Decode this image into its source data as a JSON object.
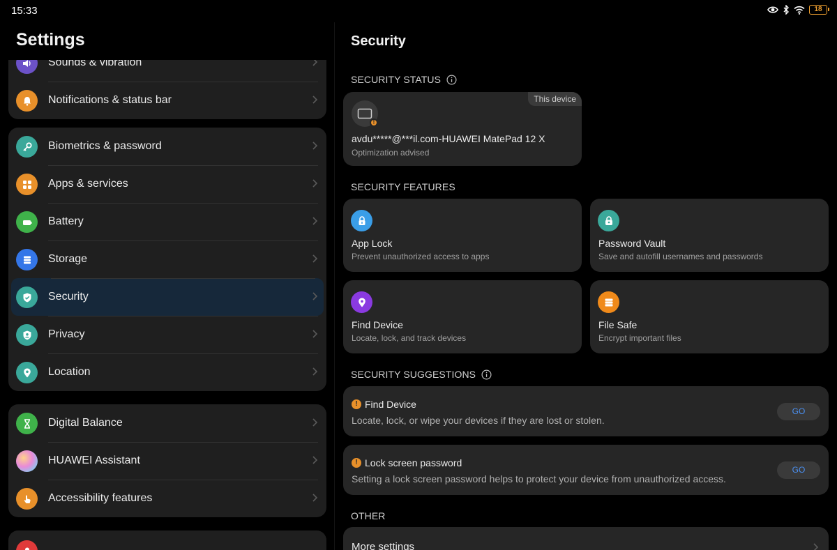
{
  "status_bar": {
    "time": "15:33",
    "battery": "18"
  },
  "left": {
    "title": "Settings",
    "groups": [
      {
        "items": [
          {
            "label": "Sounds & vibration",
            "icon": "speaker-icon",
            "color": "#6c52c8"
          },
          {
            "label": "Notifications & status bar",
            "icon": "bell-icon",
            "color": "#e8902a"
          }
        ]
      },
      {
        "items": [
          {
            "label": "Biometrics & password",
            "icon": "key-icon",
            "color": "#3aa89a"
          },
          {
            "label": "Apps & services",
            "icon": "apps-grid-icon",
            "color": "#e8902a"
          },
          {
            "label": "Battery",
            "icon": "battery-icon",
            "color": "#3fb24a"
          },
          {
            "label": "Storage",
            "icon": "storage-icon",
            "color": "#3476e8"
          },
          {
            "label": "Security",
            "icon": "shield-check-icon",
            "color": "#3aa89a",
            "selected": true
          },
          {
            "label": "Privacy",
            "icon": "privacy-shield-icon",
            "color": "#3aa89a"
          },
          {
            "label": "Location",
            "icon": "location-pin-icon",
            "color": "#3aa89a"
          }
        ]
      },
      {
        "items": [
          {
            "label": "Digital Balance",
            "icon": "hourglass-icon",
            "color": "#3fb24a"
          },
          {
            "label": "HUAWEI Assistant",
            "icon": "assistant-orb-icon",
            "color": "#c08ad8"
          },
          {
            "label": "Accessibility features",
            "icon": "hand-icon",
            "color": "#e8902a"
          }
        ]
      }
    ]
  },
  "right": {
    "title": "Security",
    "status_header": "SECURITY STATUS",
    "device_card": {
      "tag": "This device",
      "name": "avdu*****@***il.com-HUAWEI MatePad 12 X",
      "sub": "Optimization advised"
    },
    "features_header": "SECURITY FEATURES",
    "features": [
      {
        "title": "App Lock",
        "sub": "Prevent unauthorized access to apps",
        "icon": "padlock-icon",
        "color": "#3a9ee8"
      },
      {
        "title": "Password Vault",
        "sub": "Save and autofill usernames and passwords",
        "icon": "vault-lock-icon",
        "color": "#3aa89a"
      },
      {
        "title": "Find Device",
        "sub": "Locate, lock, and track devices",
        "icon": "find-pin-icon",
        "color": "#8a3ae0"
      },
      {
        "title": "File Safe",
        "sub": "Encrypt important files",
        "icon": "file-safe-icon",
        "color": "#f08a1a"
      }
    ],
    "suggestions_header": "SECURITY SUGGESTIONS",
    "suggestions": [
      {
        "title": "Find Device",
        "sub": "Locate, lock, or wipe your devices if they are lost or stolen.",
        "action": "GO"
      },
      {
        "title": "Lock screen password",
        "sub": "Setting a lock screen password helps to protect your device from unauthorized access.",
        "action": "GO"
      }
    ],
    "other_header": "OTHER",
    "more_settings": "More settings"
  },
  "colors": {
    "accent": "#4a8ff0",
    "selected_bg": "#16283a",
    "card_bg": "#262626",
    "group_bg": "#1f1f1f",
    "warning": "#e8902a"
  }
}
